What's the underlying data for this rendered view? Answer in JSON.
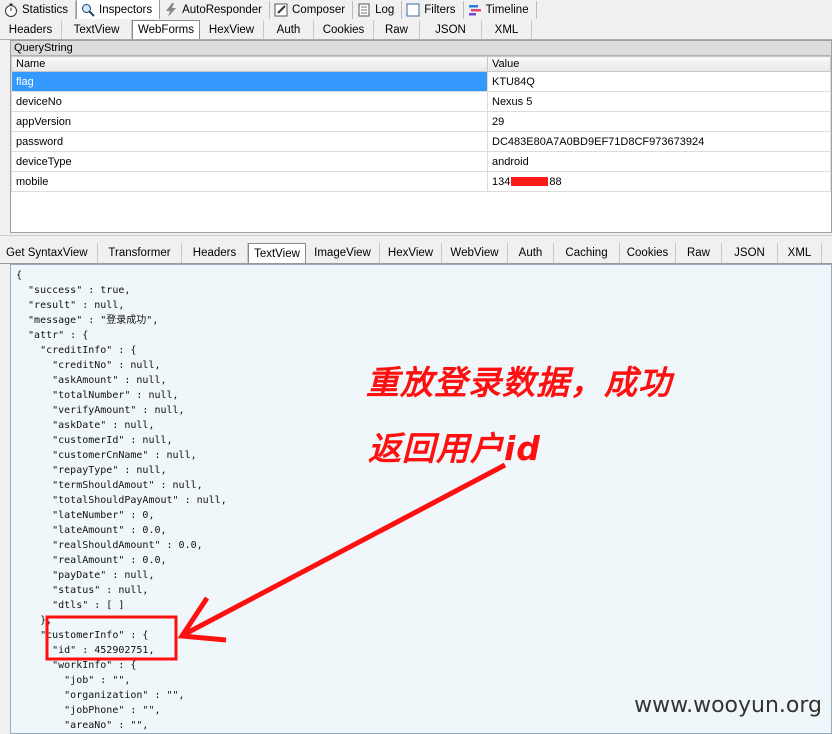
{
  "top_tabs": [
    {
      "label": "Statistics",
      "icon": "stopwatch-icon"
    },
    {
      "label": "Inspectors",
      "icon": "magnifier-icon"
    },
    {
      "label": "AutoResponder",
      "icon": "lightning-icon"
    },
    {
      "label": "Composer",
      "icon": "pencil-icon"
    },
    {
      "label": "Log",
      "icon": "log-icon"
    },
    {
      "label": "Filters",
      "icon": "checkbox-icon"
    },
    {
      "label": "Timeline",
      "icon": "timeline-icon"
    }
  ],
  "request_tabs": [
    "Headers",
    "TextView",
    "WebForms",
    "HexView",
    "Auth",
    "Cookies",
    "Raw",
    "JSON",
    "XML"
  ],
  "querystring": {
    "title": "QueryString",
    "columns": [
      "Name",
      "Value"
    ],
    "rows": [
      {
        "name": "flag",
        "value": "KTU84Q"
      },
      {
        "name": "deviceNo",
        "value": "Nexus 5"
      },
      {
        "name": "appVersion",
        "value": "29"
      },
      {
        "name": "password",
        "value": "DC483E80A7A0BD9EF71D8CF973673924"
      },
      {
        "name": "deviceType",
        "value": "android"
      },
      {
        "name": "mobile",
        "value_prefix": "134",
        "value_suffix": "88"
      }
    ]
  },
  "response_tabs": [
    "Get SyntaxView",
    "Transformer",
    "Headers",
    "TextView",
    "ImageView",
    "HexView",
    "WebView",
    "Auth",
    "Caching",
    "Cookies",
    "Raw",
    "JSON",
    "XML"
  ],
  "response_text": [
    "{",
    "  \"success\" : true,",
    "  \"result\" : null,",
    "  \"message\" : \"登录成功\",",
    "  \"attr\" : {",
    "    \"creditInfo\" : {",
    "      \"creditNo\" : null,",
    "      \"askAmount\" : null,",
    "      \"totalNumber\" : null,",
    "      \"verifyAmount\" : null,",
    "      \"askDate\" : null,",
    "      \"customerId\" : null,",
    "      \"customerCnName\" : null,",
    "      \"repayType\" : null,",
    "      \"termShouldAmout\" : null,",
    "      \"totalShouldPayAmout\" : null,",
    "      \"lateNumber\" : 0,",
    "      \"lateAmount\" : 0.0,",
    "      \"realShouldAmount\" : 0.0,",
    "      \"realAmount\" : 0.0,",
    "      \"payDate\" : null,",
    "      \"status\" : null,",
    "      \"dtls\" : [ ]",
    "    },",
    "    \"customerInfo\" : {",
    "      \"id\" : 452902751,",
    "      \"workInfo\" : {",
    "        \"job\" : \"\",",
    "        \"organization\" : \"\",",
    "        \"jobPhone\" : \"\",",
    "        \"areaNo\" : \"\","
  ],
  "annotation": {
    "line1": "重放登录数据，成功",
    "line2": "返回用户id",
    "color": "#ff1010"
  },
  "watermark": "www.wooyun.org",
  "selected": {
    "top_tab": "Inspectors",
    "request_tab": "WebForms",
    "response_tab": "TextView",
    "row": "flag"
  }
}
